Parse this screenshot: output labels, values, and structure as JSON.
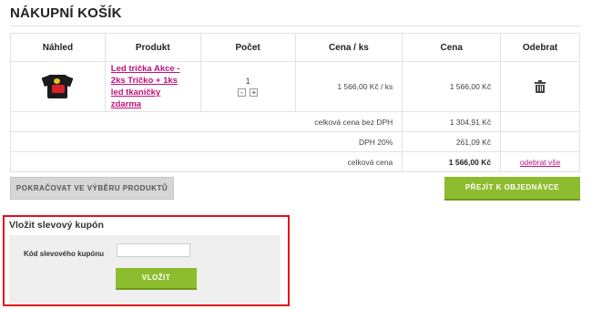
{
  "page": {
    "title": "NÁKUPNÍ KOŠÍK"
  },
  "cart": {
    "headers": {
      "preview": "Náhled",
      "product": "Produkt",
      "quantity": "Počet",
      "unit_price": "Cena / ks",
      "price": "Cena",
      "remove": "Odebrat"
    },
    "item": {
      "image_icon": "tshirt-product-thumbnail",
      "name": "Led trička Akce - 2ks Tričko + 1ks led tkaničky zdarma",
      "quantity": "1",
      "minus": "-",
      "plus": "+",
      "unit_price": "1 566,00 Kč / ks",
      "price": "1 566,00 Kč",
      "remove_icon": "trash-icon"
    },
    "summary": {
      "net_label": "celková cena bez DPH",
      "net_value": "1 304,91 Kč",
      "vat_label": "DPH 20%",
      "vat_value": "261,09 Kč",
      "total_label": "celková cena",
      "total_value": "1 566,00 Kč",
      "remove_all": "odebrat vše"
    }
  },
  "actions": {
    "continue": "POKRAČOVAT VE VÝBĚRU PRODUKTŮ",
    "checkout": "PŘEJÍT K OBJEDNÁVCE"
  },
  "coupon": {
    "title": "Vložit slevový kupón",
    "label": "Kód slevového kupónu",
    "value": "",
    "submit": "VLOŽIT"
  },
  "colors": {
    "accent_green": "#8dbd2f",
    "link_magenta": "#c0127a",
    "highlight_red": "#e0121e"
  }
}
